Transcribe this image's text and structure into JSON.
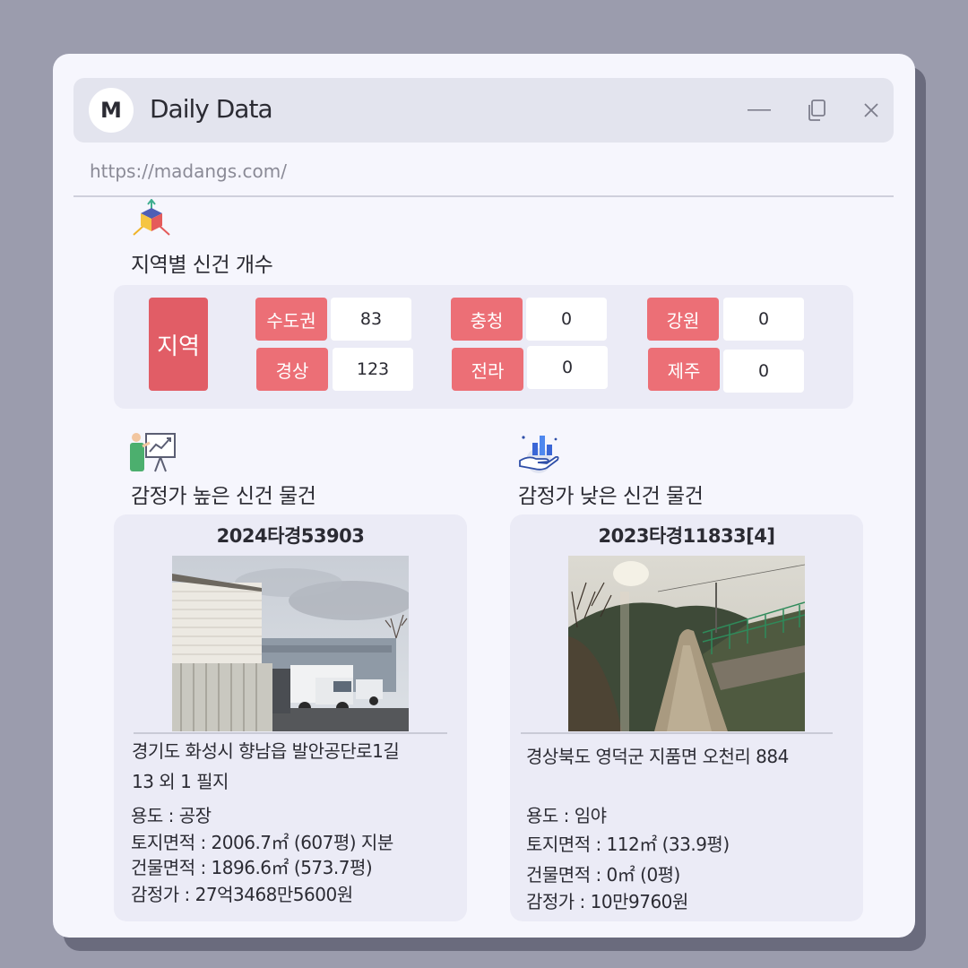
{
  "window": {
    "logo_letter": "M",
    "title": "Daily Data",
    "url": "https://madangs.com/"
  },
  "region_section": {
    "title": "지역별 신건 개수",
    "icon": "cube-axes-icon",
    "main_label": "지역",
    "regions": [
      {
        "name": "수도권",
        "count": "83"
      },
      {
        "name": "경상",
        "count": "123"
      },
      {
        "name": "충청",
        "count": "0"
      },
      {
        "name": "전라",
        "count": "0"
      },
      {
        "name": "강원",
        "count": "0"
      },
      {
        "name": "제주",
        "count": "0"
      }
    ]
  },
  "high_section": {
    "title": "감정가 높은 신건 물건",
    "icon": "presentation-chart-icon",
    "case_no": "2024타경53903",
    "address_line1": "경기도 화성시 향남읍 발안공단로1길",
    "address_line2": "13 외 1 필지",
    "usage": "용도 : 공장",
    "land_area": "토지면적 : 2006.7㎡ (607평) 지분",
    "building_area": "건물면적 : 1896.6㎡ (573.7평)",
    "appraisal": "감정가 : 27억3468만5600원"
  },
  "low_section": {
    "title": "감정가 낮은 신건 물건",
    "icon": "hand-bar-chart-icon",
    "case_no": "2023타경11833[4]",
    "address_line1": "경상북도 영덕군 지품면 오천리 884",
    "usage": "용도 : 임야",
    "land_area": "토지면적 : 112㎡ (33.9평)",
    "building_area": "건물면적 : 0㎡ (0평)",
    "appraisal": "감정가 : 10만9760원"
  },
  "colors": {
    "region_main": "#e15d66",
    "region_chip": "#ec6f76",
    "window_bg": "#f6f6fd",
    "page_bg": "#9b9cad"
  }
}
